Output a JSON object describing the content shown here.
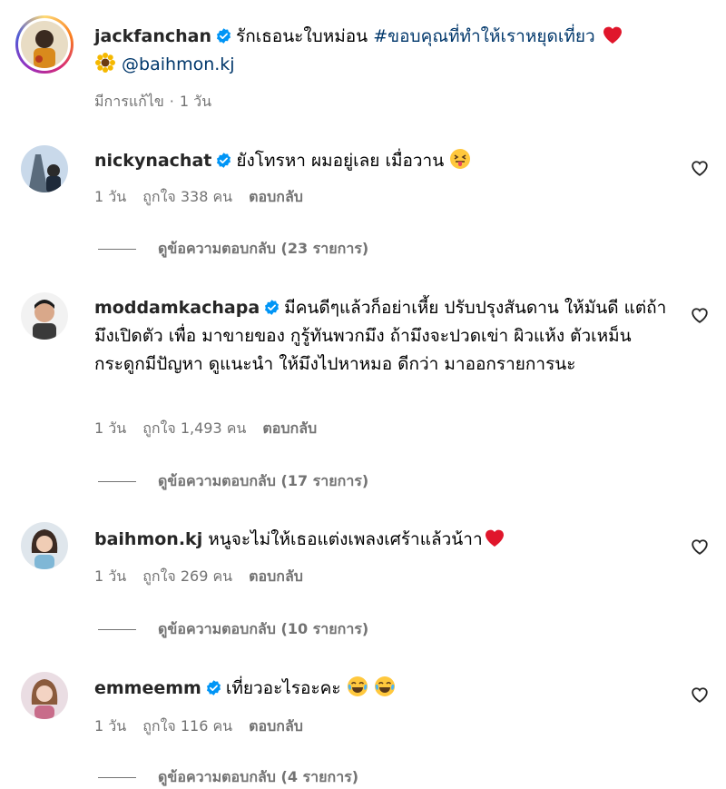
{
  "post": {
    "username": "jackfanchan",
    "caption_text": "รักเธอนะใบหม่อน",
    "hashtag": "#ขอบคุณที่ทำให้เราหยุดเที่ยว",
    "mention": "@baihmon.kj",
    "edited_label": "มีการแก้ไข",
    "time": "1 วัน"
  },
  "comments": [
    {
      "username": "nickynachat",
      "verified": true,
      "text": "ยังโทรหา ผมอยู่เลย เมื่อวาน",
      "time": "1 วัน",
      "likes": "ถูกใจ 338 คน",
      "reply_label": "ตอบกลับ",
      "view_replies": "ดูข้อความตอบกลับ (23 รายการ)"
    },
    {
      "username": "moddamkachapa",
      "verified": true,
      "text": "มีคนดีๆแล้วก็อย่าเหี้ย ปรับปรุงสันดาน ให้มันดี แต่ถ้ามึงเปิดตัว เพื่อ มาขายของ กูรู้ทันพวกมึง ถ้ามึงจะปวดเข่า ผิวแห้ง ตัวเหม็น กระดูกมีปัญหา ดูแนะนำ ให้มึงไปหาหมอ ดีกว่า มาออกรายการนะ",
      "time": "1 วัน",
      "likes": "ถูกใจ 1,493 คน",
      "reply_label": "ตอบกลับ",
      "view_replies": "ดูข้อความตอบกลับ (17 รายการ)"
    },
    {
      "username": "baihmon.kj",
      "verified": false,
      "text": "หนูจะไม่ให้เธอแต่งเพลงเศร้าแล้วน้าา",
      "time": "1 วัน",
      "likes": "ถูกใจ 269 คน",
      "reply_label": "ตอบกลับ",
      "view_replies": "ดูข้อความตอบกลับ (10 รายการ)"
    },
    {
      "username": "emmeemm",
      "verified": true,
      "text": "เที่ยวอะไรอะคะ",
      "time": "1 วัน",
      "likes": "ถูกใจ 116 คน",
      "reply_label": "ตอบกลับ",
      "view_replies": "ดูข้อความตอบกลับ (4 รายการ)"
    }
  ],
  "colors": {
    "verified_blue": "#0095f6",
    "link_blue": "#00376b",
    "muted_gray": "#737373"
  }
}
